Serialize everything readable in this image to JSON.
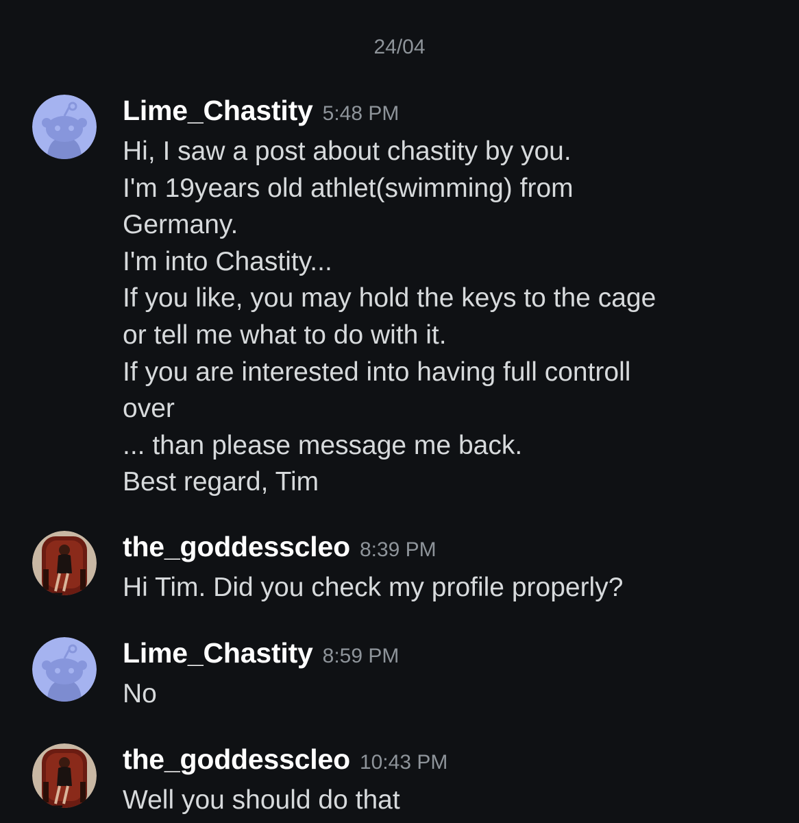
{
  "date_divider": "24/04",
  "messages": [
    {
      "username": "Lime_Chastity",
      "time": "5:48 PM",
      "avatar": "reddit-snoo-default-avatar",
      "lines": [
        "Hi, I saw a post about chastity by you.",
        "I'm 19years old athlet(swimming) from",
        "Germany.",
        "I'm into Chastity...",
        "If you like, you may hold the keys to the cage",
        "or tell me what to do with it.",
        "If you are interested into having full controll",
        "over",
        "... than please message me back.",
        "Best regard, Tim"
      ]
    },
    {
      "username": "the_goddesscleo",
      "time": "8:39 PM",
      "avatar": "photo-avatar-seated-woman",
      "lines": [
        "Hi Tim. Did you check my profile properly?"
      ]
    },
    {
      "username": "Lime_Chastity",
      "time": "8:59 PM",
      "avatar": "reddit-snoo-default-avatar",
      "lines": [
        "No"
      ]
    },
    {
      "username": "the_goddesscleo",
      "time": "10:43 PM",
      "avatar": "photo-avatar-seated-woman",
      "lines": [
        "Well you should do that"
      ]
    }
  ],
  "colors": {
    "background": "#0f1114",
    "username": "#ffffff",
    "message_text": "#d7dadc",
    "timestamp": "#8e949a",
    "snoo_avatar_bg": "#a5b3f0"
  }
}
